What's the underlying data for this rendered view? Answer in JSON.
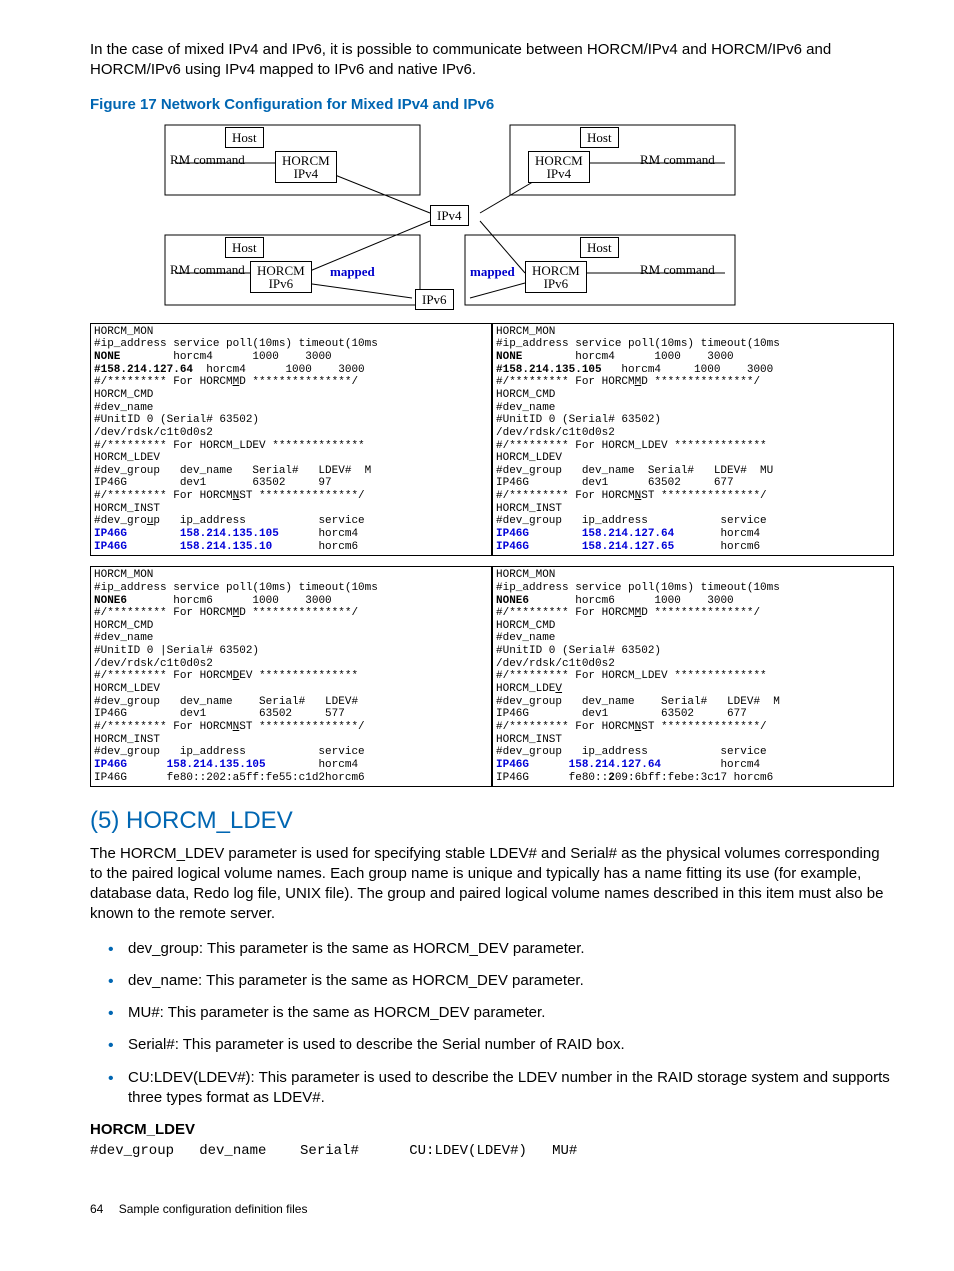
{
  "intro": "In the case of mixed IPv4 and IPv6, it is possible to communicate between HORCM/IPv4 and HORCM/IPv6 and HORCM/IPv6 using IPv4 mapped to IPv6 and native IPv6.",
  "figure_caption": "Figure 17 Network Configuration for Mixed IPv4 and IPv6",
  "diagram": {
    "host": "Host",
    "rm_command": "RM command",
    "horcm_ipv4_a": "HORCM",
    "horcm_ipv4_b": "IPv4",
    "horcm_ipv6_a": "HORCM",
    "horcm_ipv6_b": "IPv6",
    "ipv4": "IPv4",
    "ipv6": "IPv6",
    "mapped": "mapped"
  },
  "conf": {
    "tl": "HORCM_MON\n#ip_address service poll(10ms) timeout(10ms\n<b>NONE</b>        horcm4      1000    3000\n<b>#158.214.127.64</b>  horcm4      1000    3000\n#/********* For HORCM<u>M</u>D ***************/\nHORCM_CMD\n#dev_name\n#UnitID 0 (Serial# 63502)\n/dev/rdsk/c1t0d0s2\n#/********* For HORCM_LDEV **************\nHORCM_LDEV\n#dev_group   dev_name   Serial#   LDEV#  M\nIP46G        dev1       63502     97\n#/********* For HORCM<u>N</u>ST ***************/\nHORCM_INST\n#dev_gro<u>u</u>p   ip_address           service\n<bl>IP46G        158.214.135.105</bl>      horcm4\n<bl>IP46G        158.214.135.10</bl>       horcm6",
    "tr": "HORCM_MON\n#ip_address service poll(10ms) timeout(10ms\n<b>NONE</b>        horcm4      1000    3000\n<b>#158.214.135.105</b>   horcm4     1000    3000\n#/********* For HORCM<u>M</u>D ***************/\nHORCM_CMD\n#dev_name\n#UnitID 0 (Serial# 63502)\n/dev/rdsk/c1t0d0s2\n#/********* For HORCM_LDEV **************\nHORCM_LDEV\n#dev_group   dev_name  Serial#   LDEV#  MU\nIP46G        dev1      63502     677\n#/********* For HORCM<u>N</u>ST ***************/\nHORCM_INST\n#dev_group   ip_address           service\n<bl>IP46G        158.214.127.64</bl>       horcm4\n<bl>IP46G        158.214.127.65</bl>       horcm6",
    "bl": "HORCM_MON\n#ip_address service poll(10ms) timeout(10ms\n<b>NONE6</b>       horcm6      1000    3000\n#/********* For HORCM<u>M</u>D ***************/\nHORCM_CMD\n#dev_name\n#UnitID 0 |Serial# 63502)\n/dev/rdsk/c1t0d0s2\n#/********* For HORCM<u>D</u>EV ***************\nHORCM_LDEV\n#dev_group   dev_name    Serial#   LDEV#\nIP46G        dev1        63502     577\n#/********* For HORCM<u>N</u>ST ***************/\nHORCM_INST\n#dev_group   ip_address           service\n<bl>IP46G      158.214.135.105</bl>        horcm4\nIP46G      fe80::202:a5ff:fe55:c1d2horcm6",
    "br": "HORCM_MON\n#ip_address service poll(10ms) timeout(10ms\n<b>NONE6</b>       horcm6      1000    3000\n#/********* For HORCM<u>M</u>D ***************/\nHORCM_CMD\n#dev_name\n#UnitID 0 (Serial# 63502)\n/dev/rdsk/c1t0d0s2\n#/********* For HORCM_LDEV **************\nHORCM_LDE<u>V</u>\n#dev_group   dev_name    Serial#   LDEV#  M\nIP46G        dev1        63502     677\n#/********* For HORCM<u>N</u>ST ***************/\nHORCM_INST\n#dev_group   ip_address           service\n<bl>IP46G      158.214.127.64</bl>         horcm4\nIP46G      fe80::<b>2</b>09:6bff:febe:3c17 horcm6"
  },
  "section_title": "(5) HORCM_LDEV",
  "section_body": "The HORCM_LDEV parameter is used for specifying stable LDEV# and Serial# as the physical volumes corresponding to the paired logical volume names. Each group name is unique and typically has a name fitting its use (for example, database data, Redo log file, UNIX file). The group and paired logical volume names described in this item must also be known to the remote server.",
  "bullets": [
    "dev_group: This parameter is the same as HORCM_DEV parameter.",
    "dev_name: This parameter is the same as HORCM_DEV parameter.",
    "MU#: This parameter is the same as HORCM_DEV parameter.",
    "Serial#: This parameter is used to describe the Serial number of RAID box.",
    "CU:LDEV(LDEV#): This parameter is used to describe the LDEV number in the RAID storage system and supports three types format as LDEV#."
  ],
  "label": "HORCM_LDEV",
  "code_line": "#dev_group   dev_name    Serial#      CU:LDEV(LDEV#)   MU#",
  "footer_page": "64",
  "footer_text": "Sample configuration definition files"
}
